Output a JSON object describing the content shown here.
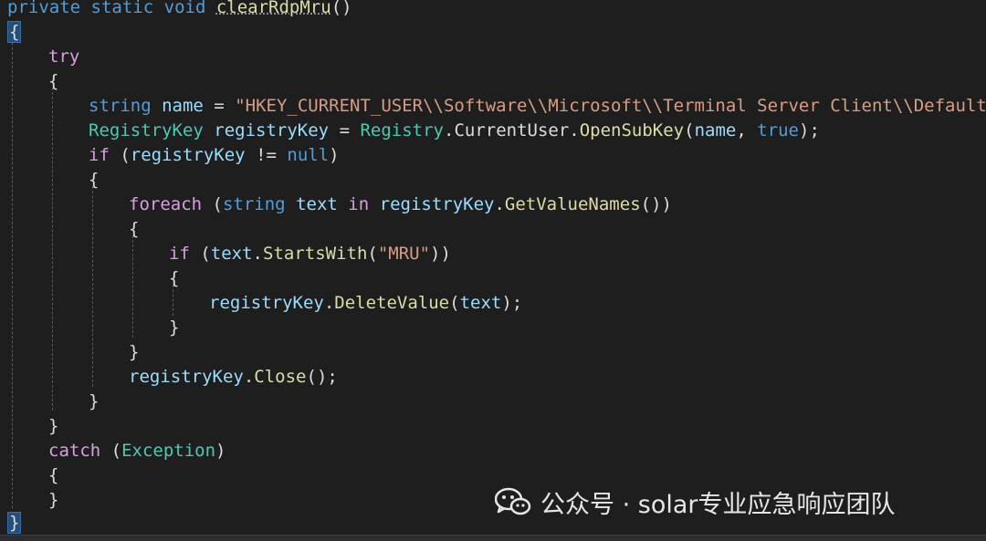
{
  "editor": {
    "lines": {
      "l1": {
        "kw_private": "private",
        "kw_static": "static",
        "kw_void": "void",
        "method": "clearRdpMru",
        "parens": "()"
      },
      "l2": {
        "open": "{"
      },
      "l3": {
        "kw": "try"
      },
      "l4": {
        "open": "{"
      },
      "l5": {
        "kw": "string",
        "var": "name",
        "eq": " = ",
        "str": "\"HKEY_CURRENT_USER\\\\Software\\\\Microsoft\\\\Terminal Server Client\\\\Default\"",
        "end": ";"
      },
      "l6": {
        "type": "RegistryKey",
        "var": "registryKey",
        "eq": " = ",
        "cls": "Registry",
        "dot1": ".",
        "prop": "CurrentUser",
        "dot2": ".",
        "fn": "OpenSubKey",
        "op": "(",
        "arg1": "name",
        "comma": ", ",
        "arg2": "true",
        "cp": ");"
      },
      "l7": {
        "kw": "if",
        "op": " (",
        "var": "registryKey",
        "neq": " != ",
        "null": "null",
        "cp": ")"
      },
      "l8": {
        "open": "{"
      },
      "l9": {
        "kw": "foreach",
        "op": " (",
        "type": "string",
        "var": "text",
        "in": "in",
        "obj": "registryKey",
        "dot": ".",
        "fn": "GetValueNames",
        "cp": "())"
      },
      "l10": {
        "open": "{"
      },
      "l11": {
        "kw": "if",
        "op": " (",
        "var": "text",
        "dot": ".",
        "fn": "StartsWith",
        "op2": "(",
        "str": "\"MRU\"",
        "cp": "))"
      },
      "l12": {
        "open": "{"
      },
      "l13": {
        "obj": "registryKey",
        "dot": ".",
        "fn": "DeleteValue",
        "op": "(",
        "arg": "text",
        "cp": ");"
      },
      "l14": {
        "close": "}"
      },
      "l15": {
        "close": "}"
      },
      "l16": {
        "obj": "registryKey",
        "dot": ".",
        "fn": "Close",
        "cp": "();"
      },
      "l17": {
        "close": "}"
      },
      "l18": {
        "close": "}"
      },
      "l19": {
        "kw": "catch",
        "op": " (",
        "type": "Exception",
        "cp": ")"
      },
      "l20": {
        "open": "{"
      },
      "l21": {
        "close": "}"
      },
      "l22": {
        "close": "}"
      }
    }
  },
  "watermark": {
    "icon": "wechat-icon",
    "text": "公众号 · solar专业应急响应团队"
  },
  "colors": {
    "background": "#1e1e1e",
    "keyword": "#569cd6",
    "control_keyword": "#d8a0df",
    "type": "#4ec9b0",
    "method": "#dcdcaa",
    "variable": "#9cdcfe",
    "string": "#d69d85",
    "punctuation": "#dcdcdc",
    "brace_highlight": "#264f78"
  }
}
